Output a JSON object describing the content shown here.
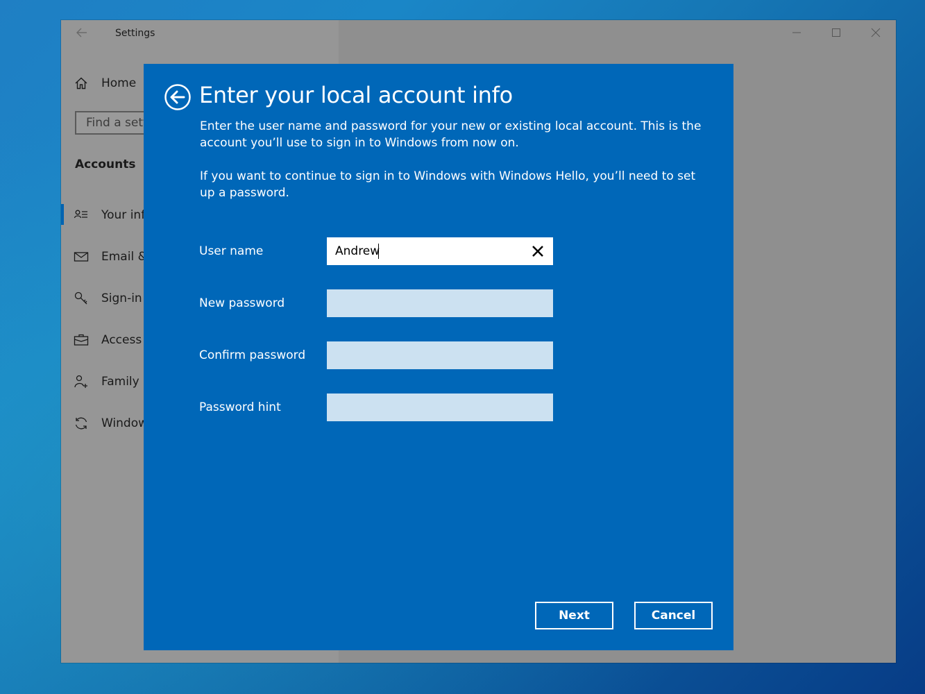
{
  "window": {
    "title": "Settings"
  },
  "sidebar": {
    "home_label": "Home",
    "search_placeholder": "Find a setting",
    "search_visible": "Find a setti",
    "section_heading": "Accounts",
    "items": [
      {
        "label": "Your inf",
        "icon": "person-list-icon"
      },
      {
        "label": "Email &",
        "icon": "mail-icon"
      },
      {
        "label": "Sign-in",
        "icon": "key-icon"
      },
      {
        "label": "Access v",
        "icon": "briefcase-icon"
      },
      {
        "label": "Family &",
        "icon": "person-add-icon"
      },
      {
        "label": "Window",
        "icon": "sync-icon"
      }
    ]
  },
  "dialog": {
    "title": "Enter your local account info",
    "description": "Enter the user name and password for your new or existing local account. This is the account you’ll use to sign in to Windows from now on.",
    "description2": "If you want to continue to sign in to Windows with Windows Hello, you’ll need to set up a password.",
    "fields": {
      "username": {
        "label": "User name",
        "value": "Andrew"
      },
      "new_password": {
        "label": "New password",
        "value": ""
      },
      "confirm_password": {
        "label": "Confirm password",
        "value": ""
      },
      "password_hint": {
        "label": "Password hint",
        "value": ""
      }
    },
    "next_label": "Next",
    "cancel_label": "Cancel"
  },
  "colors": {
    "dialog_bg": "#0067b8",
    "input_inactive": "#cce1f1",
    "accent": "#0063b1"
  }
}
